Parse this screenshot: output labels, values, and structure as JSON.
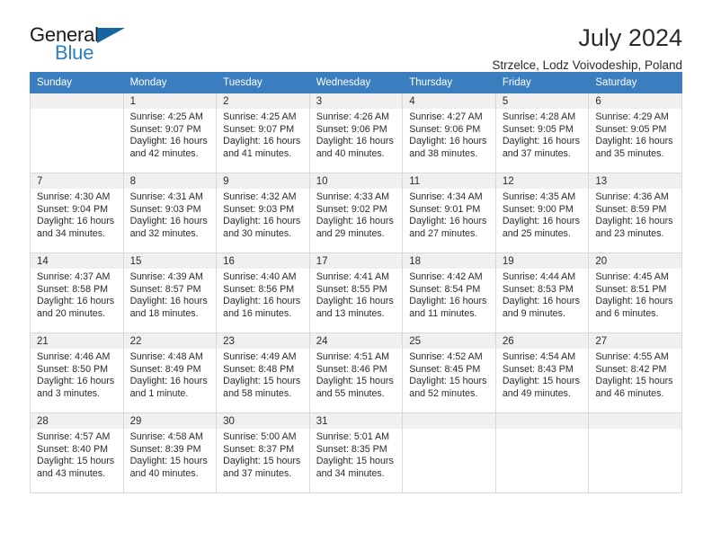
{
  "brand": {
    "name_part1": "General",
    "name_part2": "Blue",
    "triangle_color": "#15659f",
    "blue_color": "#2a7fc9"
  },
  "header": {
    "title": "July 2024",
    "subtitle": "Strzelce, Lodz Voivodeship, Poland"
  },
  "theme": {
    "header_bg": "#3a7ebf",
    "header_text": "#ffffff",
    "daynum_bg": "#f0f0f0",
    "cell_border": "#d8d8d8"
  },
  "weekdays": [
    "Sunday",
    "Monday",
    "Tuesday",
    "Wednesday",
    "Thursday",
    "Friday",
    "Saturday"
  ],
  "weeks": [
    [
      {
        "day": "",
        "sunrise": "",
        "sunset": "",
        "daylight1": "",
        "daylight2": ""
      },
      {
        "day": "1",
        "sunrise": "Sunrise: 4:25 AM",
        "sunset": "Sunset: 9:07 PM",
        "daylight1": "Daylight: 16 hours",
        "daylight2": "and 42 minutes."
      },
      {
        "day": "2",
        "sunrise": "Sunrise: 4:25 AM",
        "sunset": "Sunset: 9:07 PM",
        "daylight1": "Daylight: 16 hours",
        "daylight2": "and 41 minutes."
      },
      {
        "day": "3",
        "sunrise": "Sunrise: 4:26 AM",
        "sunset": "Sunset: 9:06 PM",
        "daylight1": "Daylight: 16 hours",
        "daylight2": "and 40 minutes."
      },
      {
        "day": "4",
        "sunrise": "Sunrise: 4:27 AM",
        "sunset": "Sunset: 9:06 PM",
        "daylight1": "Daylight: 16 hours",
        "daylight2": "and 38 minutes."
      },
      {
        "day": "5",
        "sunrise": "Sunrise: 4:28 AM",
        "sunset": "Sunset: 9:05 PM",
        "daylight1": "Daylight: 16 hours",
        "daylight2": "and 37 minutes."
      },
      {
        "day": "6",
        "sunrise": "Sunrise: 4:29 AM",
        "sunset": "Sunset: 9:05 PM",
        "daylight1": "Daylight: 16 hours",
        "daylight2": "and 35 minutes."
      }
    ],
    [
      {
        "day": "7",
        "sunrise": "Sunrise: 4:30 AM",
        "sunset": "Sunset: 9:04 PM",
        "daylight1": "Daylight: 16 hours",
        "daylight2": "and 34 minutes."
      },
      {
        "day": "8",
        "sunrise": "Sunrise: 4:31 AM",
        "sunset": "Sunset: 9:03 PM",
        "daylight1": "Daylight: 16 hours",
        "daylight2": "and 32 minutes."
      },
      {
        "day": "9",
        "sunrise": "Sunrise: 4:32 AM",
        "sunset": "Sunset: 9:03 PM",
        "daylight1": "Daylight: 16 hours",
        "daylight2": "and 30 minutes."
      },
      {
        "day": "10",
        "sunrise": "Sunrise: 4:33 AM",
        "sunset": "Sunset: 9:02 PM",
        "daylight1": "Daylight: 16 hours",
        "daylight2": "and 29 minutes."
      },
      {
        "day": "11",
        "sunrise": "Sunrise: 4:34 AM",
        "sunset": "Sunset: 9:01 PM",
        "daylight1": "Daylight: 16 hours",
        "daylight2": "and 27 minutes."
      },
      {
        "day": "12",
        "sunrise": "Sunrise: 4:35 AM",
        "sunset": "Sunset: 9:00 PM",
        "daylight1": "Daylight: 16 hours",
        "daylight2": "and 25 minutes."
      },
      {
        "day": "13",
        "sunrise": "Sunrise: 4:36 AM",
        "sunset": "Sunset: 8:59 PM",
        "daylight1": "Daylight: 16 hours",
        "daylight2": "and 23 minutes."
      }
    ],
    [
      {
        "day": "14",
        "sunrise": "Sunrise: 4:37 AM",
        "sunset": "Sunset: 8:58 PM",
        "daylight1": "Daylight: 16 hours",
        "daylight2": "and 20 minutes."
      },
      {
        "day": "15",
        "sunrise": "Sunrise: 4:39 AM",
        "sunset": "Sunset: 8:57 PM",
        "daylight1": "Daylight: 16 hours",
        "daylight2": "and 18 minutes."
      },
      {
        "day": "16",
        "sunrise": "Sunrise: 4:40 AM",
        "sunset": "Sunset: 8:56 PM",
        "daylight1": "Daylight: 16 hours",
        "daylight2": "and 16 minutes."
      },
      {
        "day": "17",
        "sunrise": "Sunrise: 4:41 AM",
        "sunset": "Sunset: 8:55 PM",
        "daylight1": "Daylight: 16 hours",
        "daylight2": "and 13 minutes."
      },
      {
        "day": "18",
        "sunrise": "Sunrise: 4:42 AM",
        "sunset": "Sunset: 8:54 PM",
        "daylight1": "Daylight: 16 hours",
        "daylight2": "and 11 minutes."
      },
      {
        "day": "19",
        "sunrise": "Sunrise: 4:44 AM",
        "sunset": "Sunset: 8:53 PM",
        "daylight1": "Daylight: 16 hours",
        "daylight2": "and 9 minutes."
      },
      {
        "day": "20",
        "sunrise": "Sunrise: 4:45 AM",
        "sunset": "Sunset: 8:51 PM",
        "daylight1": "Daylight: 16 hours",
        "daylight2": "and 6 minutes."
      }
    ],
    [
      {
        "day": "21",
        "sunrise": "Sunrise: 4:46 AM",
        "sunset": "Sunset: 8:50 PM",
        "daylight1": "Daylight: 16 hours",
        "daylight2": "and 3 minutes."
      },
      {
        "day": "22",
        "sunrise": "Sunrise: 4:48 AM",
        "sunset": "Sunset: 8:49 PM",
        "daylight1": "Daylight: 16 hours",
        "daylight2": "and 1 minute."
      },
      {
        "day": "23",
        "sunrise": "Sunrise: 4:49 AM",
        "sunset": "Sunset: 8:48 PM",
        "daylight1": "Daylight: 15 hours",
        "daylight2": "and 58 minutes."
      },
      {
        "day": "24",
        "sunrise": "Sunrise: 4:51 AM",
        "sunset": "Sunset: 8:46 PM",
        "daylight1": "Daylight: 15 hours",
        "daylight2": "and 55 minutes."
      },
      {
        "day": "25",
        "sunrise": "Sunrise: 4:52 AM",
        "sunset": "Sunset: 8:45 PM",
        "daylight1": "Daylight: 15 hours",
        "daylight2": "and 52 minutes."
      },
      {
        "day": "26",
        "sunrise": "Sunrise: 4:54 AM",
        "sunset": "Sunset: 8:43 PM",
        "daylight1": "Daylight: 15 hours",
        "daylight2": "and 49 minutes."
      },
      {
        "day": "27",
        "sunrise": "Sunrise: 4:55 AM",
        "sunset": "Sunset: 8:42 PM",
        "daylight1": "Daylight: 15 hours",
        "daylight2": "and 46 minutes."
      }
    ],
    [
      {
        "day": "28",
        "sunrise": "Sunrise: 4:57 AM",
        "sunset": "Sunset: 8:40 PM",
        "daylight1": "Daylight: 15 hours",
        "daylight2": "and 43 minutes."
      },
      {
        "day": "29",
        "sunrise": "Sunrise: 4:58 AM",
        "sunset": "Sunset: 8:39 PM",
        "daylight1": "Daylight: 15 hours",
        "daylight2": "and 40 minutes."
      },
      {
        "day": "30",
        "sunrise": "Sunrise: 5:00 AM",
        "sunset": "Sunset: 8:37 PM",
        "daylight1": "Daylight: 15 hours",
        "daylight2": "and 37 minutes."
      },
      {
        "day": "31",
        "sunrise": "Sunrise: 5:01 AM",
        "sunset": "Sunset: 8:35 PM",
        "daylight1": "Daylight: 15 hours",
        "daylight2": "and 34 minutes."
      },
      {
        "day": "",
        "sunrise": "",
        "sunset": "",
        "daylight1": "",
        "daylight2": ""
      },
      {
        "day": "",
        "sunrise": "",
        "sunset": "",
        "daylight1": "",
        "daylight2": ""
      },
      {
        "day": "",
        "sunrise": "",
        "sunset": "",
        "daylight1": "",
        "daylight2": ""
      }
    ]
  ]
}
